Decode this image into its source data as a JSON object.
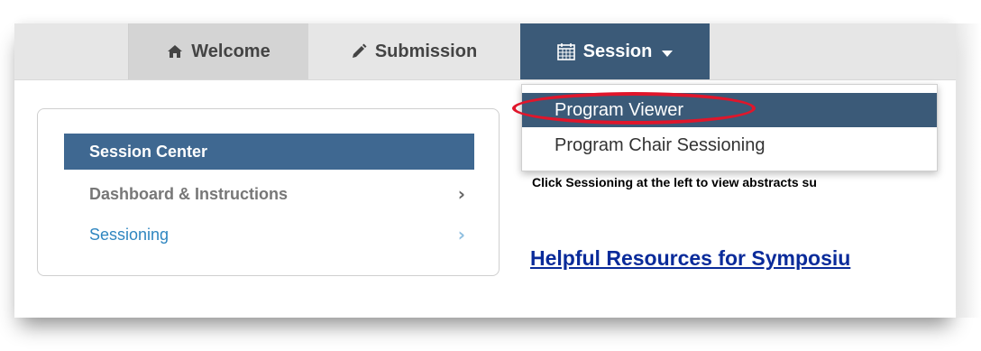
{
  "nav": {
    "tabs": [
      {
        "label": "Welcome",
        "icon": "home-icon"
      },
      {
        "label": "Submission",
        "icon": "pencil-icon"
      },
      {
        "label": "Session",
        "icon": "calendar-icon"
      }
    ]
  },
  "dropdown": {
    "items": [
      {
        "label": "Program Viewer"
      },
      {
        "label": "Program Chair Sessioning"
      }
    ]
  },
  "panel": {
    "header": "Session Center",
    "items": [
      {
        "label": "Dashboard & Instructions"
      },
      {
        "label": "Sessioning"
      }
    ]
  },
  "content": {
    "instruction_clipped": "Click Sessioning at the left to view abstracts su",
    "resources_link": "Helpful Resources for Symposiu"
  },
  "colors": {
    "active_tab": "#3b5a78",
    "panel_header": "#3f6891",
    "link": "#0a2b9a",
    "highlight": "#e0162b"
  }
}
